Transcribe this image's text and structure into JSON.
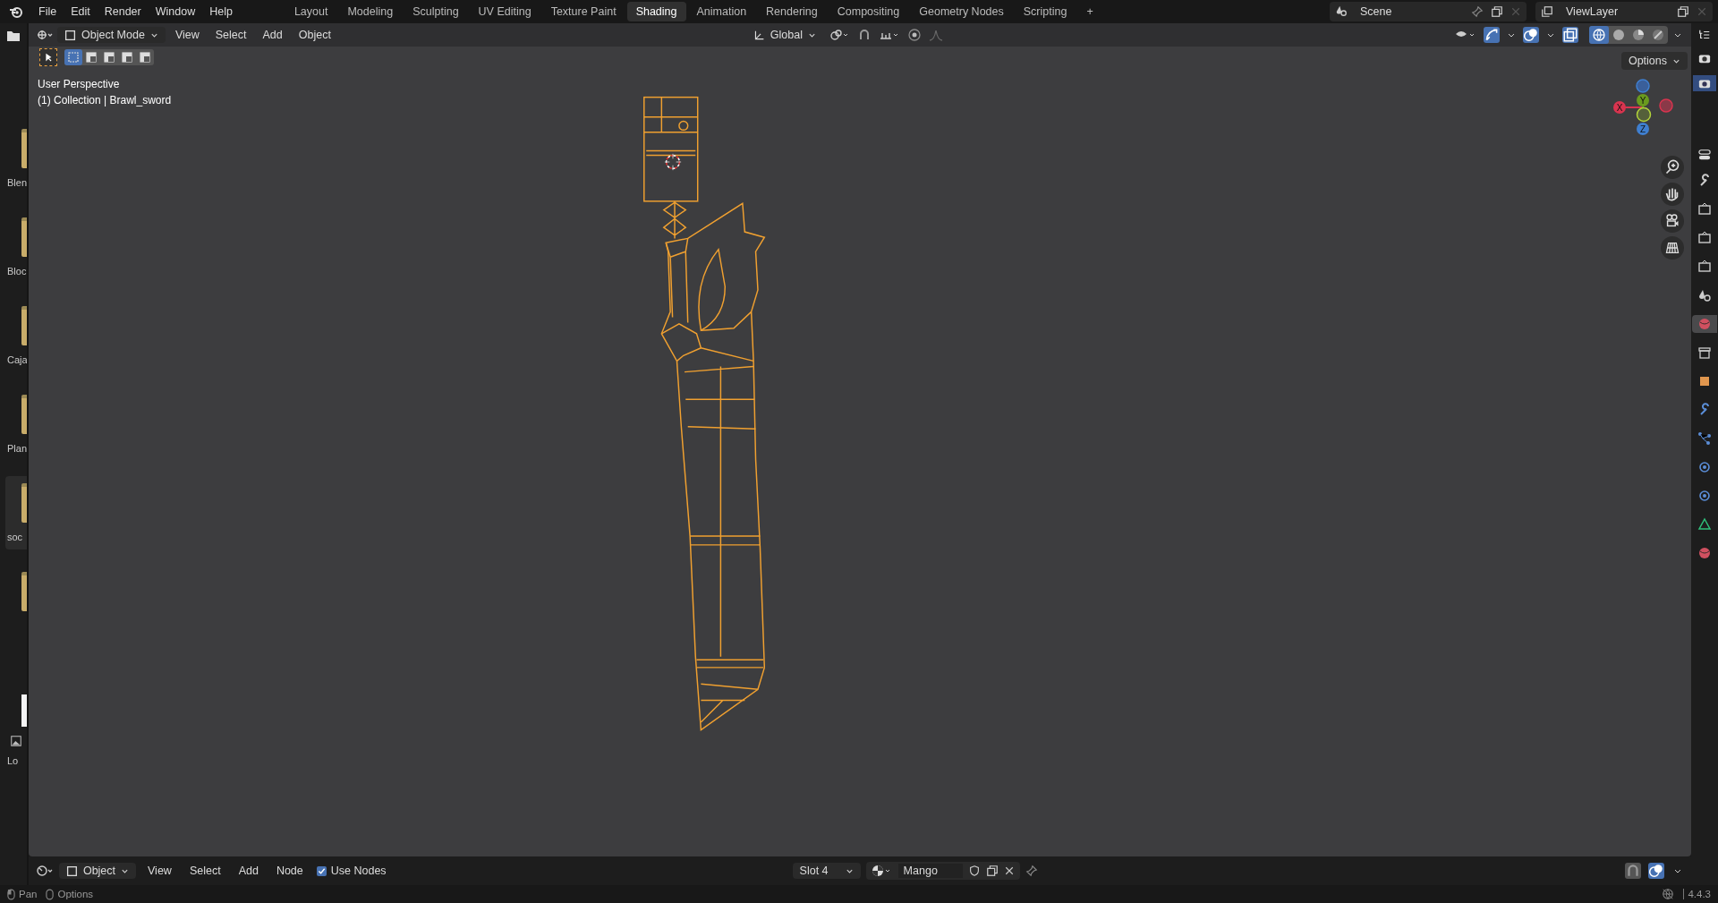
{
  "app_menu": [
    "File",
    "Edit",
    "Render",
    "Window",
    "Help"
  ],
  "workspaces": [
    {
      "label": "Layout",
      "selected": false
    },
    {
      "label": "Modeling",
      "selected": false
    },
    {
      "label": "Sculpting",
      "selected": false
    },
    {
      "label": "UV Editing",
      "selected": false
    },
    {
      "label": "Texture Paint",
      "selected": false
    },
    {
      "label": "Shading",
      "selected": true
    },
    {
      "label": "Animation",
      "selected": false
    },
    {
      "label": "Rendering",
      "selected": false
    },
    {
      "label": "Compositing",
      "selected": false
    },
    {
      "label": "Geometry Nodes",
      "selected": false
    },
    {
      "label": "Scripting",
      "selected": false
    }
  ],
  "add_workspace": "+",
  "scene": "Scene",
  "view_layer": "ViewLayer",
  "viewport_header": {
    "mode": "Object Mode",
    "menus": [
      "View",
      "Select",
      "Add",
      "Object"
    ],
    "orientation": "Global"
  },
  "select_modes": [
    {
      "selected": true
    },
    {
      "selected": false
    },
    {
      "selected": false
    },
    {
      "selected": false
    },
    {
      "selected": false
    }
  ],
  "shading_modes": [
    {
      "selected": true
    },
    {
      "selected": false
    },
    {
      "selected": false
    },
    {
      "selected": false
    }
  ],
  "options": "Options",
  "overlay": {
    "view": "User Perspective",
    "object": "(1) Collection | Brawl_sword"
  },
  "gizmo_axes": [
    "X",
    "Y",
    "Z"
  ],
  "asset_strip": [
    {
      "kind": "folder",
      "label": "Blen",
      "selected": false
    },
    {
      "kind": "folder",
      "label": "Bloc",
      "selected": false
    },
    {
      "kind": "folder",
      "label": "Caja",
      "selected": false
    },
    {
      "kind": "folder",
      "label": "Plan",
      "selected": false
    },
    {
      "kind": "folder",
      "label": "soc",
      "selected": true
    },
    {
      "kind": "folder",
      "selected": false
    },
    {
      "kind": "image",
      "label": "Lo",
      "selected": false
    }
  ],
  "properties_tabs": [
    {
      "kind": "tool",
      "selected": false
    },
    {
      "kind": "render",
      "selected": false
    },
    {
      "kind": "output",
      "selected": false
    },
    {
      "kind": "view_layer",
      "selected": false
    },
    {
      "kind": "scene",
      "selected": false
    },
    {
      "kind": "world",
      "selected": true
    },
    {
      "kind": "collection",
      "selected": false
    },
    {
      "kind": "object",
      "selected": false
    },
    {
      "kind": "modifiers",
      "selected": false
    },
    {
      "kind": "particles",
      "selected": false
    },
    {
      "kind": "physics",
      "selected": false
    },
    {
      "kind": "constraints",
      "selected": false
    },
    {
      "kind": "data",
      "selected": false
    },
    {
      "kind": "material",
      "selected": false
    }
  ],
  "node_header": {
    "editor": "Object",
    "menus": [
      "View",
      "Select",
      "Add",
      "Node"
    ],
    "use_nodes": {
      "label": "Use Nodes",
      "checked": true
    },
    "slot": "Slot 4",
    "material": "Mango"
  },
  "status_bar": {
    "hints": [
      "Pan",
      "Options"
    ],
    "version": "4.4.3"
  }
}
